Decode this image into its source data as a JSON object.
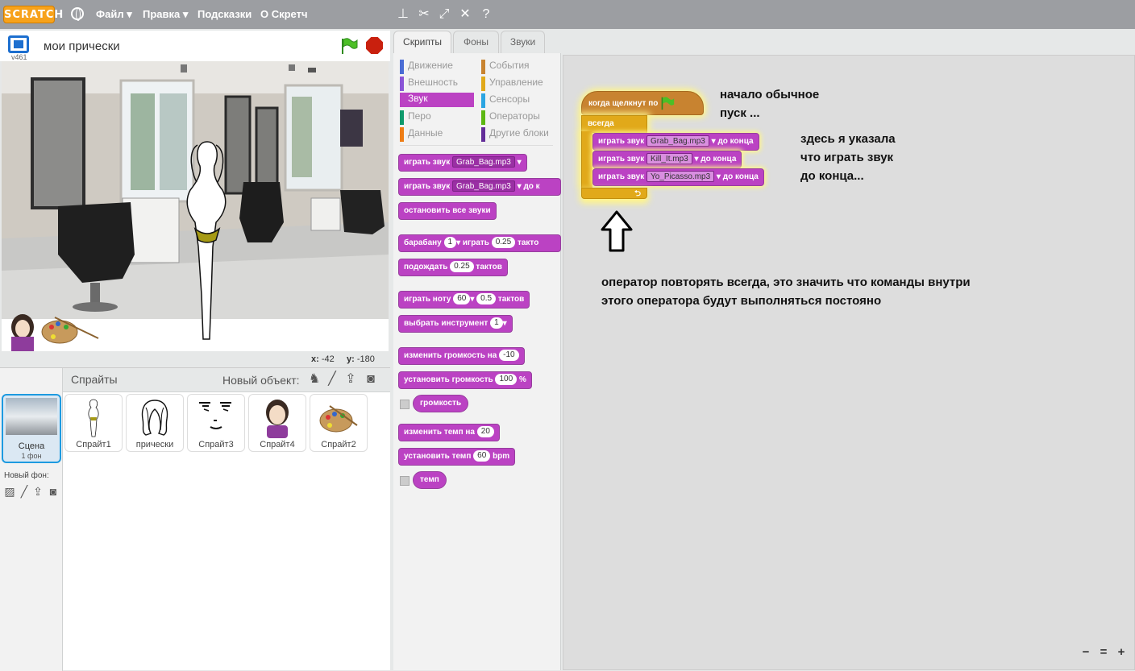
{
  "menu": {
    "logo": "SCRATCH",
    "file": "Файл ▾",
    "edit": "Правка ▾",
    "tips": "Подсказки",
    "about": "О Скретч"
  },
  "stage": {
    "version": "v461",
    "project_title": "мои прически",
    "x_label": "x:",
    "x_value": "-42",
    "y_label": "y:",
    "y_value": "-180"
  },
  "sprites_pane": {
    "title": "Спрайты",
    "new_object": "Новый объект:",
    "scene_label": "Сцена",
    "scene_sub": "1 фон",
    "new_backdrop": "Новый фон:",
    "sprites": [
      {
        "name": "Спрайт1"
      },
      {
        "name": "прически"
      },
      {
        "name": "Спрайт3"
      },
      {
        "name": "Спрайт4"
      },
      {
        "name": "Спрайт2"
      }
    ]
  },
  "tabs": [
    "Скрипты",
    "Фоны",
    "Звуки"
  ],
  "categories": {
    "motion": "Движение",
    "looks": "Внешность",
    "sound": "Звук",
    "pen": "Перо",
    "data": "Данные",
    "events": "События",
    "control": "Управление",
    "sensing": "Сенсоры",
    "operators": "Операторы",
    "more": "Другие блоки"
  },
  "palette_blocks": {
    "play_sound": "играть звук",
    "play_sound_sound": "Grab_Bag.mp3",
    "play_sound_until": "играть звук",
    "play_sound_until_sound": "Grab_Bag.mp3",
    "play_sound_until_tail": "до к",
    "stop_all": "остановить все звуки",
    "drum": "барабану",
    "drum_num": "1",
    "drum_play": "играть",
    "drum_beats": "0.25",
    "drum_tail": "такто",
    "rest": "подождать",
    "rest_beats": "0.25",
    "rest_tail": "тактов",
    "note": "играть ноту",
    "note_num": "60",
    "note_beats": "0.5",
    "note_tail": "тактов",
    "instrument": "выбрать инструмент",
    "instrument_num": "1",
    "change_volume": "изменить громкость на",
    "change_volume_val": "-10",
    "set_volume": "установить громкость",
    "set_volume_val": "100",
    "set_volume_unit": "%",
    "volume": "громкость",
    "change_tempo": "изменить темп на",
    "change_tempo_val": "20",
    "set_tempo": "установить темп",
    "set_tempo_val": "60",
    "set_tempo_unit": "bpm",
    "tempo": "темп"
  },
  "script": {
    "hat": "когда щелкнут по",
    "forever": "всегда",
    "play1": "играть звук",
    "play1_sound": "Grab_Bag.mp3",
    "play1_tail": "до конца",
    "play2": "играть звук",
    "play2_sound": "Kill_It.mp3",
    "play2_tail": "до конца",
    "play3": "играть звук",
    "play3_sound": "Yo_Picasso.mp3",
    "play3_tail": "до конца",
    "loop_arrow": "⮌"
  },
  "notes": {
    "note1_line1": "начало обычное",
    "note1_line2": "пуск ...",
    "note2_line1": "здесь я указала",
    "note2_line2": "что играть звук",
    "note2_line3": "до конца...",
    "note3_line1": "оператор повторять всегда, это значить что команды внутри",
    "note3_line2": "этого оператора будут выполняться постояно"
  },
  "zoom": {
    "out": "−",
    "reset": "=",
    "in": "+"
  },
  "colors": {
    "sound": "#bb42c3",
    "events": "#c88330",
    "control": "#e1a91a",
    "motion": "#4a6cd4",
    "looks": "#8a55d7",
    "pen": "#0e9a6c",
    "data": "#ee7d16",
    "sensing": "#2ca5e2",
    "operators": "#5cb712",
    "more": "#632d99"
  }
}
